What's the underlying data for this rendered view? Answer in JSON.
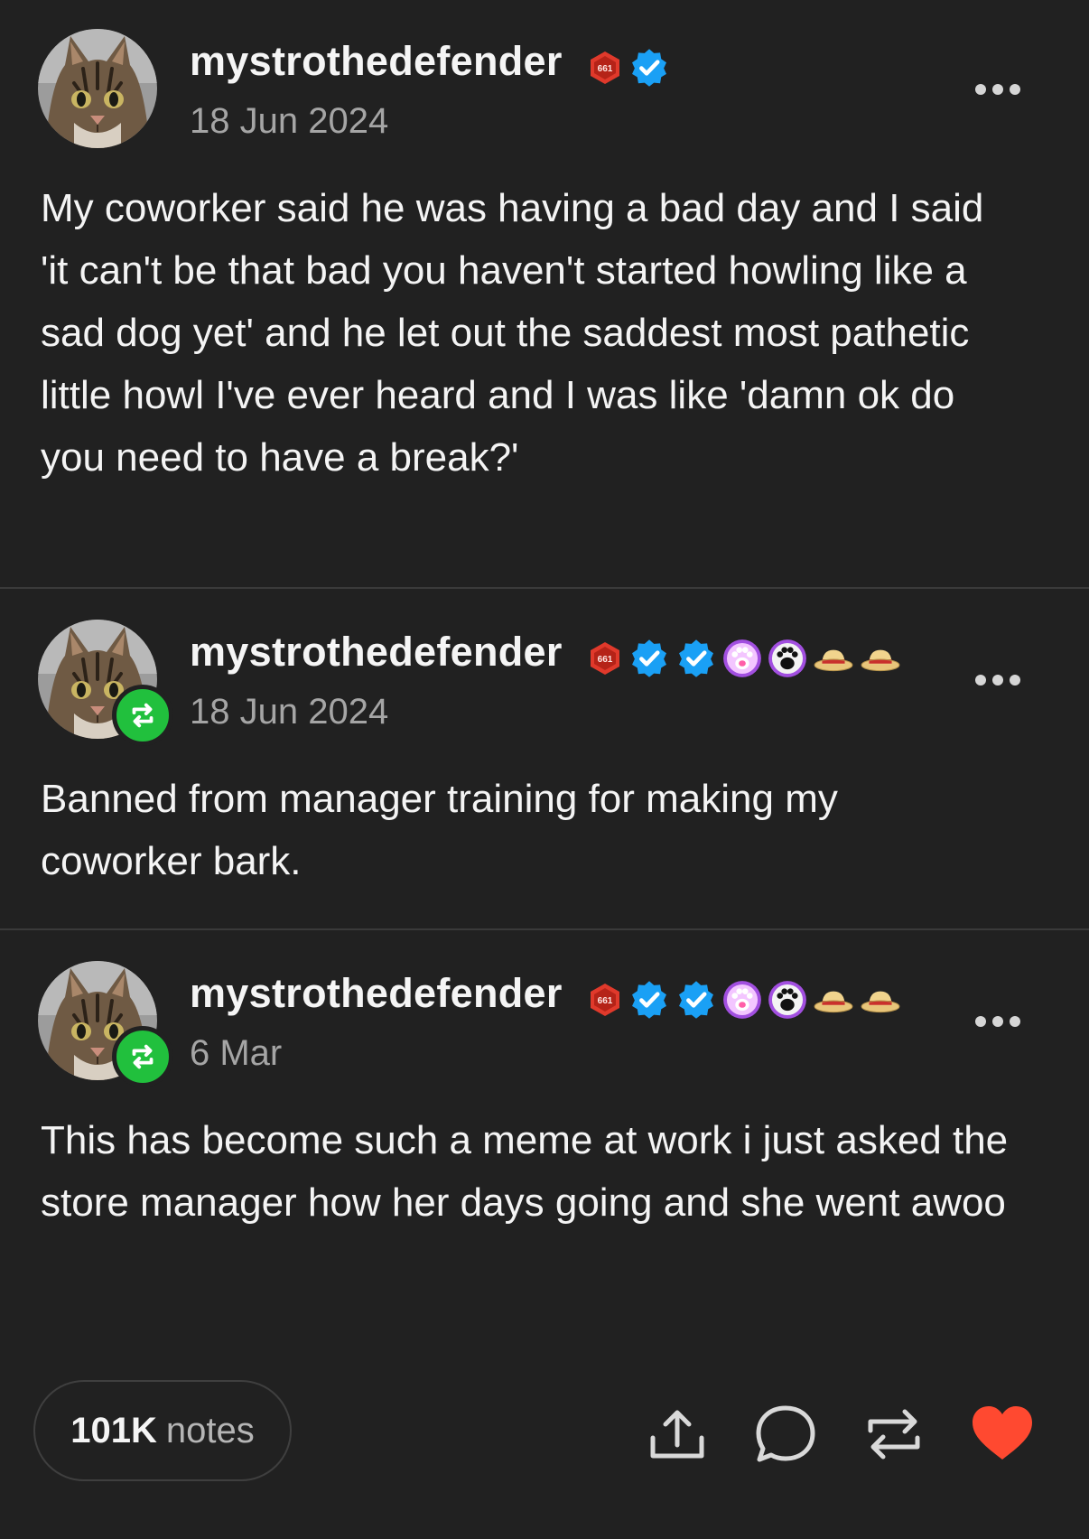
{
  "posts": [
    {
      "username": "mystrothedefender",
      "date": "18 Jun 2024",
      "is_reblog": false,
      "badges": [
        "hex-badge-icon",
        "verified-check-icon"
      ],
      "text": "My coworker said he was having a bad day and I said 'it can't be that bad you haven't started howling like a sad dog yet' and he let out the saddest most pathetic little howl I've ever heard and I was like 'damn ok do you need to have a break?'"
    },
    {
      "username": "mystrothedefender",
      "date": "18 Jun 2024",
      "is_reblog": true,
      "badges": [
        "hex-badge-icon",
        "verified-check-icon",
        "verified-check-icon",
        "paw-pink-icon",
        "paw-dark-icon",
        "straw-hat-icon",
        "straw-hat-icon"
      ],
      "text": "Banned from manager training for making my coworker bark."
    },
    {
      "username": "mystrothedefender",
      "date": "6 Mar",
      "is_reblog": true,
      "badges": [
        "hex-badge-icon",
        "verified-check-icon",
        "verified-check-icon",
        "paw-pink-icon",
        "paw-dark-icon",
        "straw-hat-icon",
        "straw-hat-icon"
      ],
      "text": "This has become such a meme at work i just asked the store manager how her days going and she went awoo"
    }
  ],
  "hex_badge_label": "661",
  "footer": {
    "notes_count": "101K",
    "notes_label": "notes",
    "actions": [
      "share-icon",
      "reply-icon",
      "reblog-icon",
      "like-icon"
    ]
  },
  "colors": {
    "background": "#212121",
    "reblog_green": "#21c03d",
    "verified_blue": "#1aa0f5",
    "like_red": "#ff4930",
    "hex_badge_red": "#e0392b"
  }
}
